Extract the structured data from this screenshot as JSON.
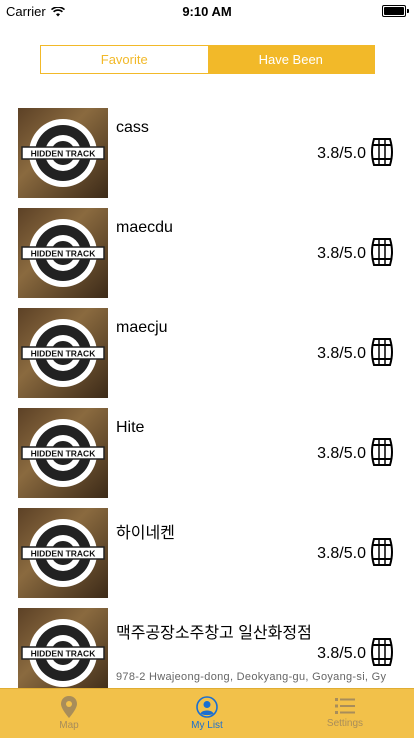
{
  "status": {
    "carrier": "Carrier",
    "time": "9:10 AM"
  },
  "segment": {
    "favorite": "Favorite",
    "have_been": "Have Been"
  },
  "items": [
    {
      "name": "cass",
      "rating": "3.8/5.0"
    },
    {
      "name": "maecdu",
      "rating": "3.8/5.0"
    },
    {
      "name": "maecju",
      "rating": "3.8/5.0"
    },
    {
      "name": "Hite",
      "rating": "3.8/5.0"
    },
    {
      "name": "하이네켄",
      "rating": "3.8/5.0"
    },
    {
      "name": "맥주공장소주창고 일산화정점",
      "rating": "3.8/5.0",
      "address": "978-2 Hwajeong-dong, Deokyang-gu, Goyang-si, Gy"
    }
  ],
  "thumb_logo_text": "HIDDEN TRACK",
  "tabs": [
    {
      "label": "Map",
      "icon": "map-pin-icon"
    },
    {
      "label": "My List",
      "icon": "person-icon"
    },
    {
      "label": "Settings",
      "icon": "list-icon"
    }
  ],
  "colors": {
    "accent": "#f2b929",
    "tabbar": "#f2c14a",
    "active_tab": "#1a6fd1"
  }
}
